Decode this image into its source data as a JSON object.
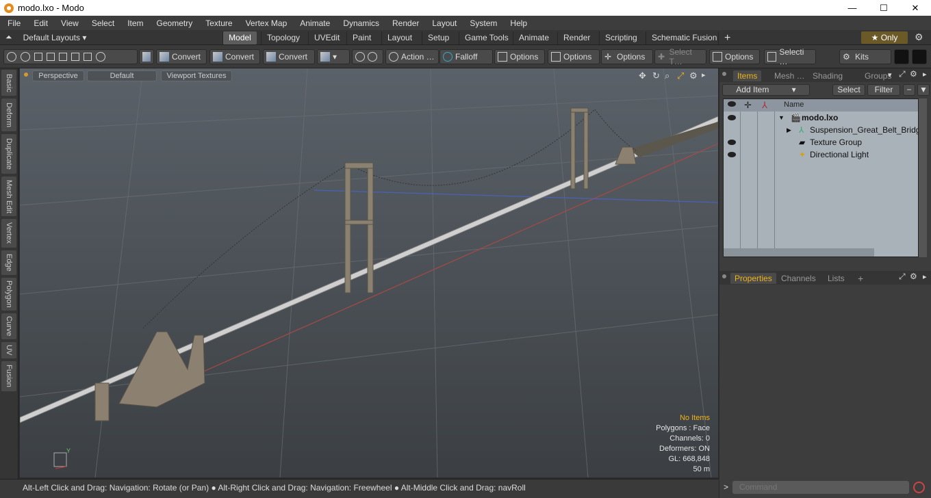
{
  "window": {
    "title": "modo.lxo - Modo",
    "min": "—",
    "max": "☐",
    "close": "✕"
  },
  "menu": [
    "File",
    "Edit",
    "View",
    "Select",
    "Item",
    "Geometry",
    "Texture",
    "Vertex Map",
    "Animate",
    "Dynamics",
    "Render",
    "Layout",
    "System",
    "Help"
  ],
  "layouts": {
    "label": "Default Layouts ▾"
  },
  "tabs": [
    "Model",
    "Topology",
    "UVEdit",
    "Paint",
    "Layout",
    "Setup",
    "Game Tools",
    "Animate",
    "Render",
    "Scripting",
    "Schematic Fusion"
  ],
  "tabs_add": "+",
  "only": {
    "label": "★  Only"
  },
  "toolbar": {
    "convert1": "Convert",
    "convert2": "Convert",
    "convert3": "Convert",
    "action": "Action  …",
    "falloff": "Falloff",
    "options1": "Options",
    "options2": "Options",
    "options3": "Options",
    "select_t": "Select T…",
    "options4": "Options",
    "selecti": "Selecti …",
    "kits": "Kits"
  },
  "lefttabs": [
    "Basic",
    "Deform",
    "Duplicate",
    "Mesh Edit",
    "Vertex",
    "Edge",
    "Polygon",
    "Curve",
    "UV",
    "Fusion"
  ],
  "viewport": {
    "perspective": "Perspective",
    "default": "Default",
    "viewport_textures": "Viewport Textures",
    "info": {
      "items": "No Items",
      "polygons": "Polygons : Face",
      "channels": "Channels: 0",
      "deformers": "Deformers: ON",
      "gl": "GL: 668,848",
      "scale": "50 m"
    },
    "axis_y": "Y"
  },
  "status": "Alt-Left Click and Drag: Navigation: Rotate (or Pan) ● Alt-Right Click and Drag: Navigation: Freewheel ● Alt-Middle Click and Drag: navRoll",
  "rightpanel": {
    "tabs": [
      "Items",
      "Mesh …",
      "Shading",
      "Groups"
    ],
    "add_item": "Add Item",
    "select": "Select",
    "filter": "Filter",
    "name_header": "Name",
    "items": [
      {
        "name": "modo.lxo"
      },
      {
        "name": "Suspension_Great_Belt_Bridge"
      },
      {
        "name": "Texture Group"
      },
      {
        "name": "Directional Light"
      }
    ],
    "props_tabs": [
      "Properties",
      "Channels",
      "Lists"
    ],
    "props_add": "+",
    "command_placeholder": "Command",
    "cmd_prompt": ">"
  },
  "colors": {
    "accent": "#f0b418",
    "panel": "#3d3d3d",
    "list_bg": "#a9b1b9"
  }
}
